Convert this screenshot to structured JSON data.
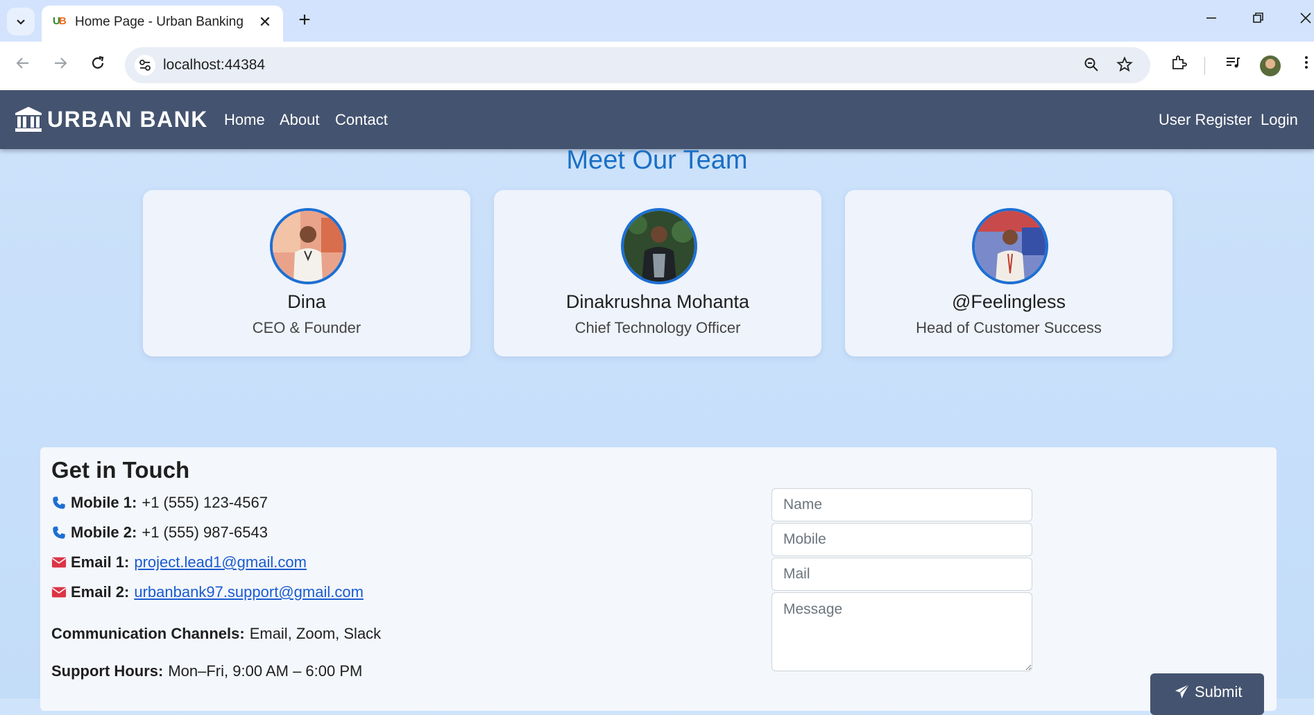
{
  "browser": {
    "tab_title": "Home Page - Urban Banking",
    "favicon_text_1": "U",
    "favicon_text_2": "B",
    "close_glyph": "✕",
    "new_tab_glyph": "+",
    "url": "localhost:44384",
    "window_controls": {
      "minimize": "—",
      "restore": "❐",
      "close": "✕"
    }
  },
  "navbar": {
    "brand": "URBAN BANK",
    "links": [
      "Home",
      "About",
      "Contact"
    ],
    "right_links": [
      "User Register",
      "Login"
    ],
    "background": "#44536f"
  },
  "team": {
    "title": "Meet Our Team",
    "members": [
      {
        "name": "Dina",
        "role": "CEO & Founder"
      },
      {
        "name": "Dinakrushna Mohanta",
        "role": "Chief Technology Officer"
      },
      {
        "name": "@Feelingless",
        "role": "Head of Customer Success"
      }
    ]
  },
  "contact": {
    "title": "Get in Touch",
    "mobile1_label": "Mobile 1:",
    "mobile1": "+1 (555) 123-4567",
    "mobile2_label": "Mobile 2:",
    "mobile2": "+1 (555) 987-6543",
    "email1_label": "Email 1:",
    "email1": "project.lead1@gmail.com",
    "email2_label": "Email 2:",
    "email2": "urbanbank97.support@gmail.com",
    "channels_label": "Communication Channels:",
    "channels": "Email, Zoom, Slack",
    "hours_label": "Support Hours:",
    "hours": "Mon–Fri, 9:00 AM – 6:00 PM"
  },
  "form": {
    "name_placeholder": "Name",
    "mobile_placeholder": "Mobile",
    "mail_placeholder": "Mail",
    "message_placeholder": "Message",
    "submit_label": "Submit"
  },
  "colors": {
    "accent": "#1a6fc4",
    "phone_icon": "#1d6fd3",
    "mail_icon": "#dc3545"
  }
}
